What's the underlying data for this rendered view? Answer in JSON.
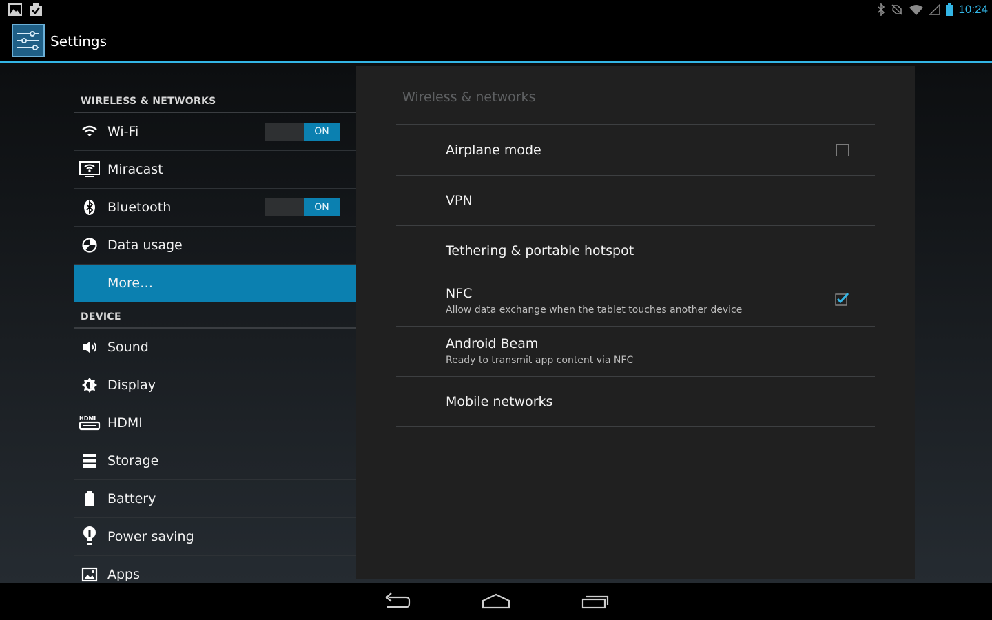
{
  "status_bar": {
    "time": "10:24",
    "left_icons": [
      "image-notification-icon",
      "clipboard-check-notification-icon"
    ],
    "right_icons": [
      "bluetooth-icon",
      "sync-icon",
      "wifi-signal-icon",
      "cell-signal-icon",
      "battery-icon"
    ]
  },
  "action_bar": {
    "title": "Settings",
    "icon": "settings-sliders-icon"
  },
  "sections": {
    "wireless": "WIRELESS & NETWORKS",
    "device": "DEVICE"
  },
  "nav": {
    "wifi": {
      "label": "Wi-Fi",
      "toggle": "ON",
      "icon": "wifi-icon"
    },
    "miracast": {
      "label": "Miracast",
      "icon": "miracast-icon"
    },
    "bluetooth": {
      "label": "Bluetooth",
      "toggle": "ON",
      "icon": "bluetooth-icon"
    },
    "data_usage": {
      "label": "Data usage",
      "icon": "data-usage-icon"
    },
    "more": {
      "label": "More…",
      "selected": true
    },
    "sound": {
      "label": "Sound",
      "icon": "sound-icon"
    },
    "display": {
      "label": "Display",
      "icon": "display-icon"
    },
    "hdmi": {
      "label": "HDMI",
      "icon": "hdmi-icon"
    },
    "storage": {
      "label": "Storage",
      "icon": "storage-icon"
    },
    "battery": {
      "label": "Battery",
      "icon": "battery-icon"
    },
    "power_saving": {
      "label": "Power saving",
      "icon": "power-saving-icon"
    },
    "apps": {
      "label": "Apps",
      "icon": "apps-icon"
    }
  },
  "panel": {
    "title": "Wireless & networks",
    "prefs": {
      "airplane": {
        "title": "Airplane mode",
        "checked": false
      },
      "vpn": {
        "title": "VPN"
      },
      "tethering": {
        "title": "Tethering & portable hotspot"
      },
      "nfc": {
        "title": "NFC",
        "summary": "Allow data exchange when the tablet touches another device",
        "checked": true
      },
      "beam": {
        "title": "Android Beam",
        "summary": "Ready to transmit app content via NFC"
      },
      "mobile": {
        "title": "Mobile networks"
      }
    }
  },
  "colors": {
    "accent": "#33b5e5",
    "selected": "#0b80b0",
    "panel": "#202020"
  },
  "navbar": {
    "buttons": [
      "back-icon",
      "home-icon",
      "recents-icon"
    ]
  }
}
